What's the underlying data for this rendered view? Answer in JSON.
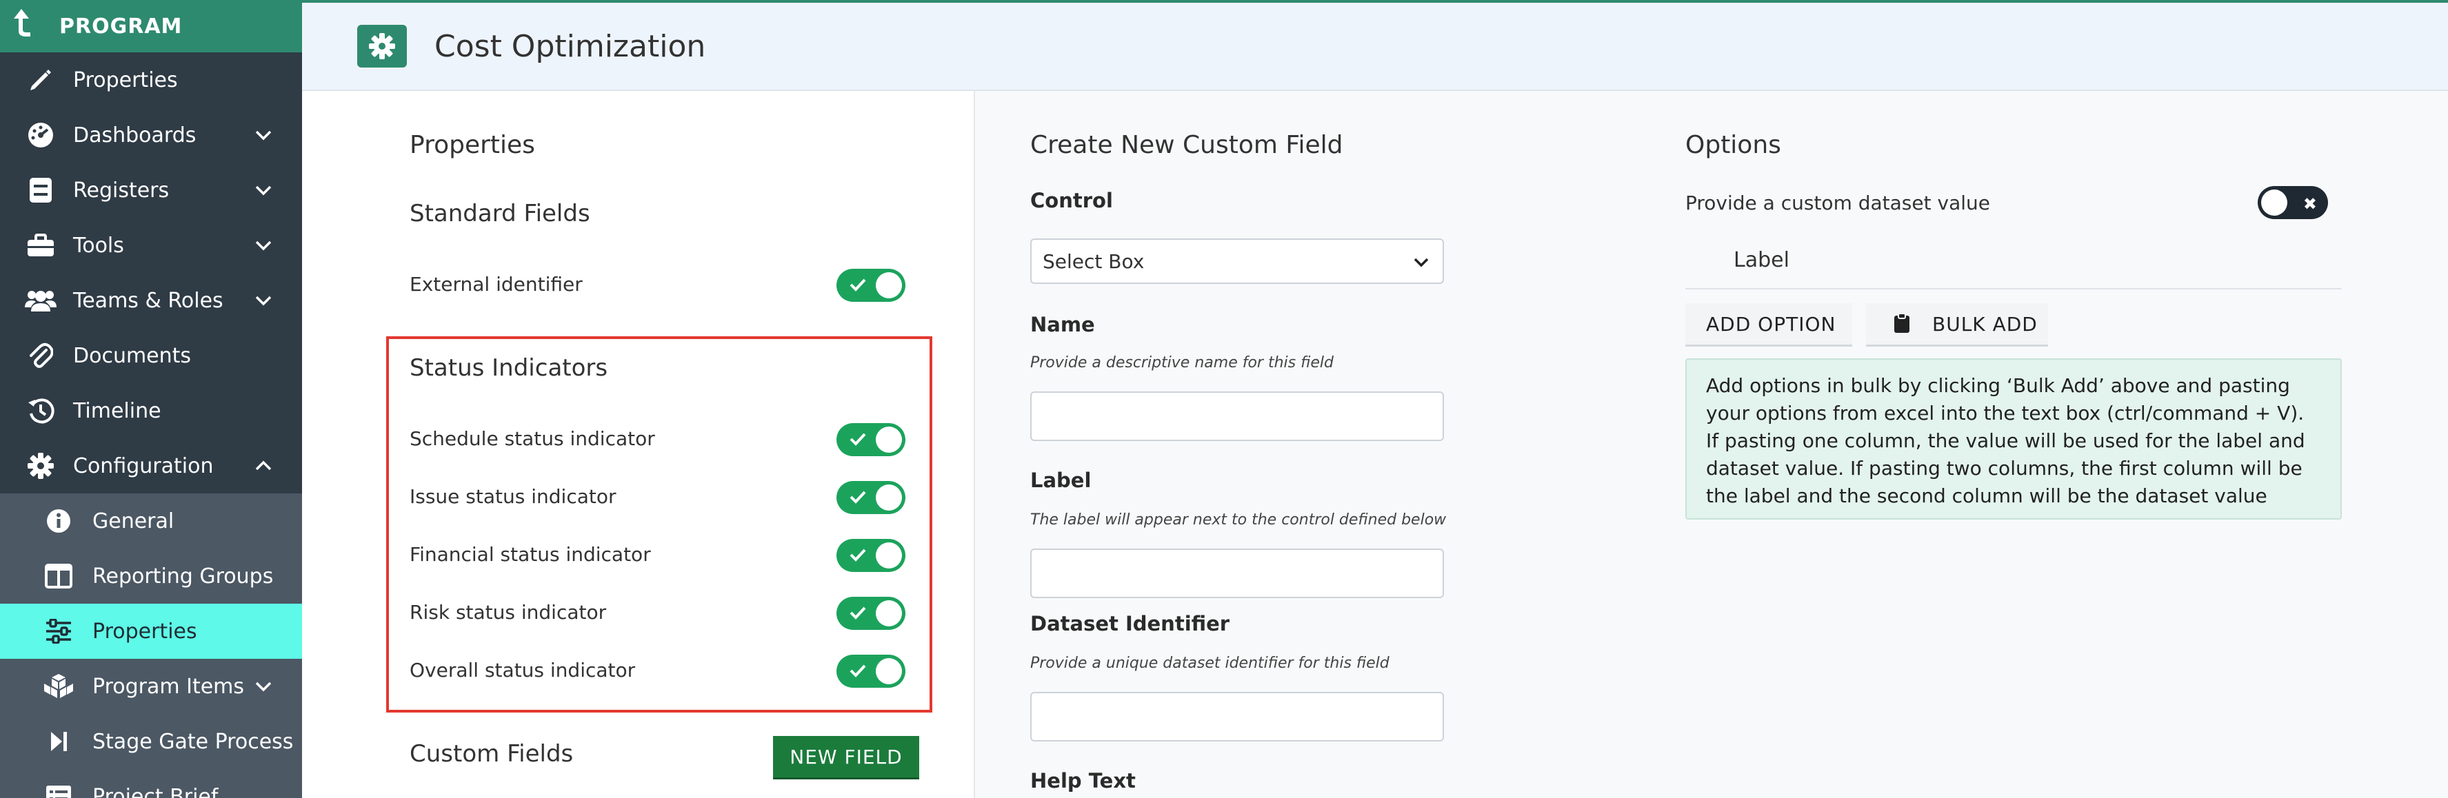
{
  "sidebar": {
    "brand": "PROGRAM",
    "items": [
      {
        "label": "Properties",
        "icon": "pencil-icon"
      },
      {
        "label": "Dashboards",
        "icon": "dashboard-icon"
      },
      {
        "label": "Registers",
        "icon": "register-icon"
      },
      {
        "label": "Tools",
        "icon": "toolbox-icon"
      },
      {
        "label": "Teams & Roles",
        "icon": "users-icon"
      },
      {
        "label": "Documents",
        "icon": "paperclip-icon"
      },
      {
        "label": "Timeline",
        "icon": "history-icon"
      },
      {
        "label": "Configuration",
        "icon": "gear-icon"
      }
    ],
    "config_sub": [
      {
        "label": "General",
        "icon": "info-icon"
      },
      {
        "label": "Reporting Groups",
        "icon": "columns-icon"
      },
      {
        "label": "Properties",
        "icon": "sliders-icon"
      },
      {
        "label": "Program Items",
        "icon": "cubes-icon"
      },
      {
        "label": "Stage Gate Process",
        "icon": "step-forward-icon"
      },
      {
        "label": "Project Brief",
        "icon": "list-icon"
      }
    ]
  },
  "header": {
    "title": "Cost Optimization"
  },
  "left": {
    "properties_heading": "Properties",
    "standard_heading": "Standard Fields",
    "external_identifier": "External identifier",
    "status_heading": "Status Indicators",
    "status_items": [
      "Schedule status indicator",
      "Issue status indicator",
      "Financial status indicator",
      "Risk status indicator",
      "Overall status indicator"
    ],
    "custom_heading": "Custom Fields",
    "new_field": "NEW FIELD"
  },
  "create": {
    "heading": "Create New Custom Field",
    "control_label": "Control",
    "control_value": "Select Box",
    "name_label": "Name",
    "name_help": "Provide a descriptive name for this field",
    "label_label": "Label",
    "label_help": "The label will appear next to the control defined below",
    "dataset_label": "Dataset Identifier",
    "dataset_help": "Provide a unique dataset identifier for this field",
    "help_text_label": "Help Text"
  },
  "options": {
    "heading": "Options",
    "custom_dataset": "Provide a custom dataset value",
    "label_col": "Label",
    "add_option": "ADD OPTION",
    "bulk_add": "BULK ADD",
    "info": "Add options in bulk by clicking ‘Bulk Add’ above and pasting your options from excel into the text box (ctrl/command + V). If pasting one column, the value will be used for the label and dataset value. If pasting two columns, the first column will be the label and the second column will be the dataset value"
  },
  "colors": {
    "brand_green": "#2e8a6e",
    "toggle_on": "#1ba35c",
    "active_nav": "#5ef9e8",
    "highlight_red": "#e3382f"
  }
}
